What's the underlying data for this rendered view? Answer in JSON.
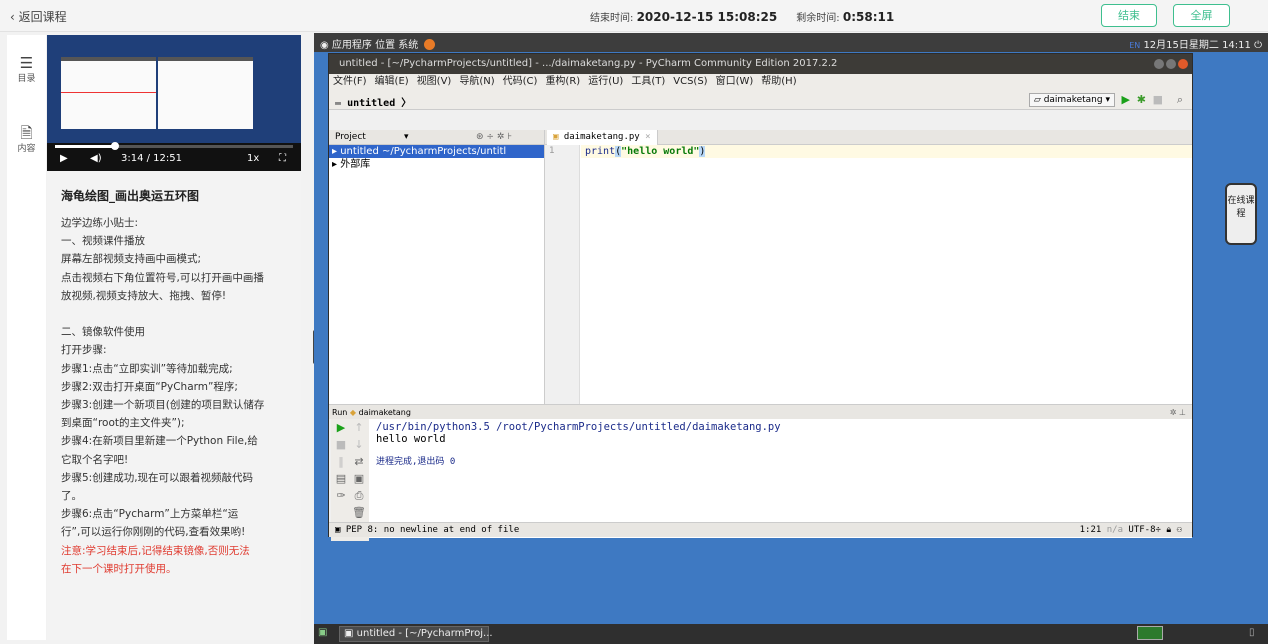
{
  "header": {
    "back_label": "返回课程",
    "end_time_label": "结束时间:",
    "end_time": "2020-12-15 15:08:25",
    "remaining_label": "剩余时间:",
    "remaining": "0:58:11",
    "end_button": "结束",
    "fullscreen_button": "全屏",
    "accent": "#3fbf8f"
  },
  "leftnav": {
    "items": [
      {
        "icon": "list-icon",
        "label": "目录"
      },
      {
        "icon": "document-icon",
        "label": "内容"
      }
    ]
  },
  "video": {
    "current_time": "3:14",
    "total_time": "12:51",
    "time_display": "3:14 / 12:51",
    "speed": "1x",
    "progress": 0.25
  },
  "lesson": {
    "title": "海龟绘图_画出奥运五环图",
    "lines": [
      "边学边练小贴士:",
      "一、视频课件播放",
      "屏幕左部视频支持画中画模式;",
      "点击视频右下角位置符号,可以打开画中画播",
      "放视频,视频支持放大、拖拽、暂停!",
      "",
      "二、镜像软件使用",
      "打开步骤:",
      "步骤1:点击“立即实训”等待加载完成;",
      "步骤2:双击打开桌面“PyCharm”程序;",
      "步骤3:创建一个新项目(创建的项目默认储存",
      "到桌面“root的主文件夹”);",
      "步骤4:在新项目里新建一个Python File,给",
      "它取个名字吧!",
      "步骤5:创建成功,现在可以跟着视频敲代码",
      "了。",
      "步骤6:点击“Pycharm”上方菜单栏“运",
      "行”,可以运行你刚刚的代码,查看效果哟!"
    ],
    "warning_lines": [
      "注意:学习结束后,记得结束镜像,否则无法",
      "在下一个课时打开使用。"
    ],
    "warning_color": "#e03c31"
  },
  "desktop": {
    "menu": [
      "应用程序",
      "位置",
      "系统"
    ],
    "lang": "EN",
    "clock": "12月15日星期二 14:11",
    "widget_label": "在线课程",
    "task_label": "untitled - [~/PycharmProj..."
  },
  "pycharm": {
    "title": "untitled - [~/PycharmProjects/untitled] - .../daimaketang.py - PyCharm Community Edition 2017.2.2",
    "menu": [
      "文件(F)",
      "编辑(E)",
      "视图(V)",
      "导航(N)",
      "代码(C)",
      "重构(R)",
      "运行(U)",
      "工具(T)",
      "VCS(S)",
      "窗口(W)",
      "帮助(H)"
    ],
    "breadcrumb": "untitled",
    "run_config": "daimaketang",
    "project_tab": "Project",
    "project_rows": [
      "untitled  ~/PycharmProjects/untitl",
      "外部库"
    ],
    "file_tab": "daimaketang.py",
    "line_number": "1",
    "code": {
      "func": "print",
      "open": "(",
      "string": "\"hello world\"",
      "close": ")"
    },
    "run_label": "Run",
    "run_name": "daimaketang",
    "console": {
      "command": "/usr/bin/python3.5 /root/PycharmProjects/untitled/daimaketang.py",
      "output": "hello world",
      "exit": "进程完成,退出码 0"
    },
    "status_left": "PEP 8: no newline at end of file",
    "status_pos": "1:21",
    "status_na": "n/a",
    "status_enc": "UTF-8÷"
  }
}
